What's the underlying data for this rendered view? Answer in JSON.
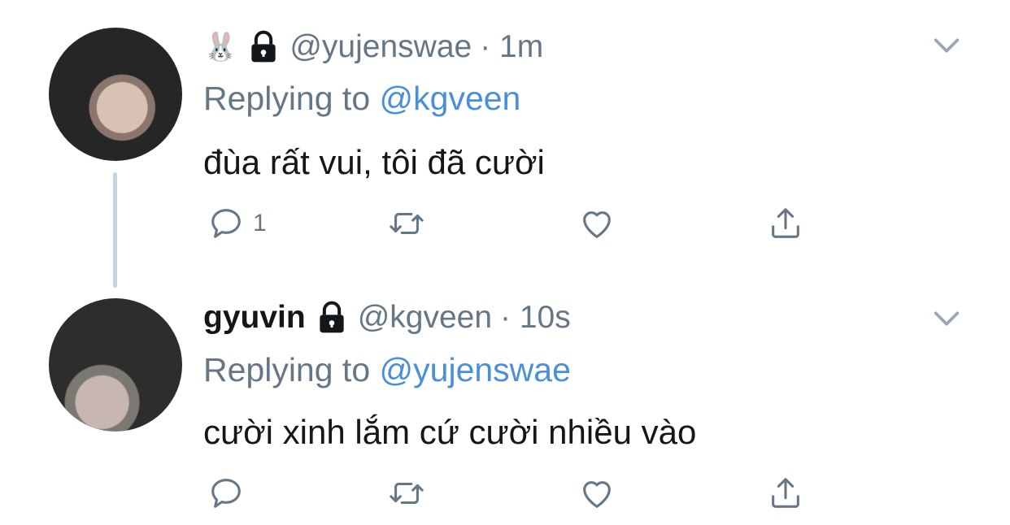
{
  "tweets": [
    {
      "name": "",
      "name_emoji": "🐰",
      "handle": "@yujenswae",
      "time": "· 1m",
      "replying_prefix": "Replying to",
      "replying_to": "@kgveen",
      "text": "đùa rất vui, tôi đã cười",
      "reply_count": "1"
    },
    {
      "name": "gyuvin",
      "handle": "@kgveen",
      "time": "· 10s",
      "replying_prefix": "Replying to",
      "replying_to": "@yujenswae",
      "text": "cười xinh lắm cứ cười nhiều vào",
      "reply_count": ""
    }
  ],
  "icons": [
    "lock-icon",
    "reply-icon",
    "retweet-icon",
    "like-icon",
    "share-icon",
    "chevron-down-icon"
  ],
  "colors": {
    "link": "#4a90d9",
    "muted": "#657786",
    "text": "#14171a",
    "thread": "#c8d3dc"
  }
}
